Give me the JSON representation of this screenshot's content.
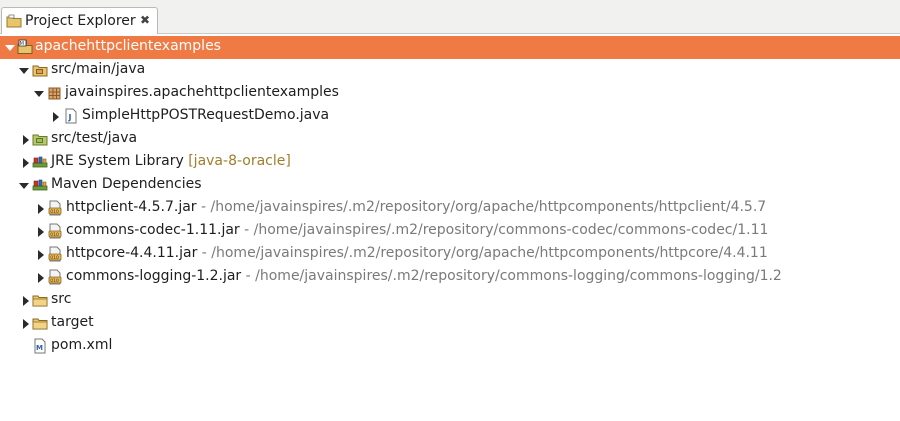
{
  "view": {
    "tab_title": "Project Explorer",
    "tab_icon": "project-explorer-icon",
    "close_glyph": "✖"
  },
  "tree": {
    "project": {
      "label": "apachehttpclientexamples",
      "icon": "maven-project-icon",
      "expanded": true,
      "selected": true
    },
    "src_main": {
      "label": "src/main/java",
      "icon": "source-folder-icon",
      "expanded": true
    },
    "package": {
      "label": "javainspires.apachehttpclientexamples",
      "icon": "package-icon",
      "expanded": true
    },
    "java_file": {
      "label": "SimpleHttpPOSTRequestDemo.java",
      "icon": "java-file-icon",
      "expanded": false
    },
    "src_test": {
      "label": "src/test/java",
      "icon": "source-folder-icon",
      "expanded": false
    },
    "jre": {
      "label": "JRE System Library",
      "decoration": "[java-8-oracle]",
      "icon": "library-icon",
      "expanded": false
    },
    "maven_deps": {
      "label": "Maven Dependencies",
      "icon": "library-icon",
      "expanded": true
    },
    "jars": [
      {
        "label": "httpclient-4.5.7.jar",
        "path": " - /home/javainspires/.m2/repository/org/apache/httpcomponents/httpclient/4.5.7",
        "icon": "jar-icon"
      },
      {
        "label": "commons-codec-1.11.jar",
        "path": " - /home/javainspires/.m2/repository/commons-codec/commons-codec/1.11",
        "icon": "jar-icon"
      },
      {
        "label": "httpcore-4.4.11.jar",
        "path": " - /home/javainspires/.m2/repository/org/apache/httpcomponents/httpcore/4.4.11",
        "icon": "jar-icon"
      },
      {
        "label": "commons-logging-1.2.jar",
        "path": " - /home/javainspires/.m2/repository/commons-logging/commons-logging/1.2",
        "icon": "jar-icon"
      }
    ],
    "src_folder": {
      "label": "src",
      "icon": "folder-icon",
      "expanded": false
    },
    "target_folder": {
      "label": "target",
      "icon": "folder-icon",
      "expanded": false
    },
    "pom": {
      "label": "pom.xml",
      "icon": "pom-file-icon"
    }
  },
  "colors": {
    "selection": "#f07a44",
    "decoration": "#a07d2b",
    "path": "#7a7a7a"
  }
}
